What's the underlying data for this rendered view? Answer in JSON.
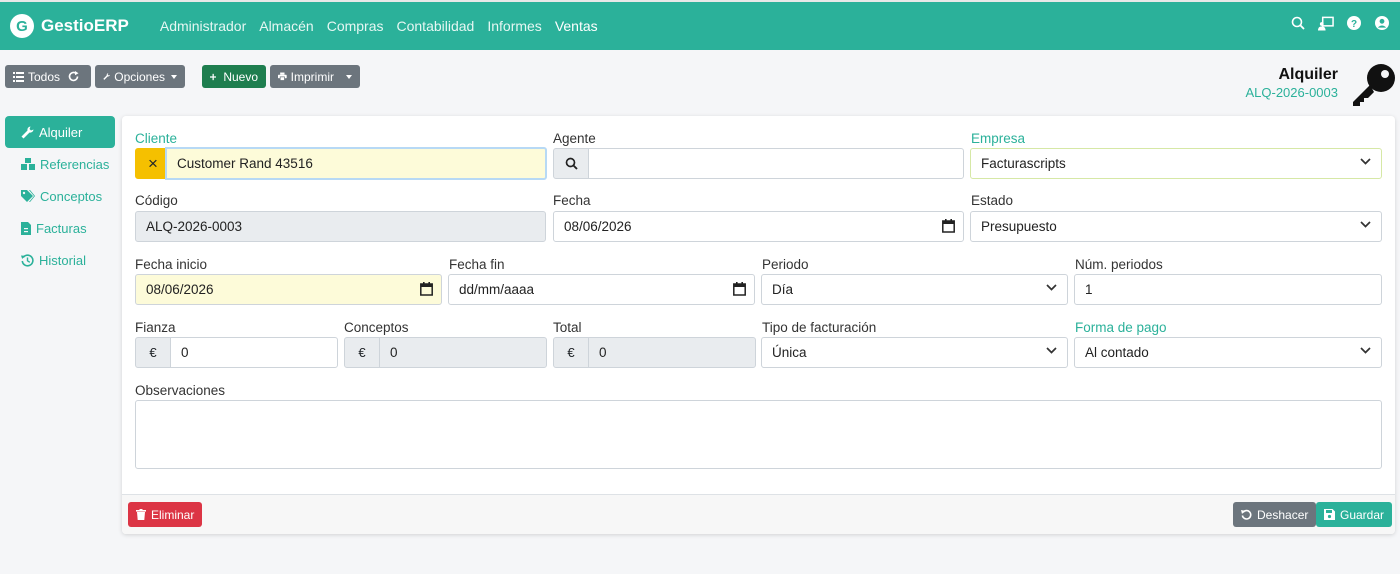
{
  "app": {
    "logo_letter": "G",
    "name": "GestioERP"
  },
  "nav": {
    "items": [
      "Administrador",
      "Almacén",
      "Compras",
      "Contabilidad",
      "Informes",
      "Ventas"
    ]
  },
  "toolbar": {
    "todos": "Todos",
    "opciones": "Opciones",
    "nuevo": "Nuevo",
    "imprimir": "Imprimir"
  },
  "header": {
    "title": "Alquiler",
    "code": "ALQ-2026-0003"
  },
  "sidebar": {
    "items": [
      "Alquiler",
      "Referencias",
      "Conceptos",
      "Facturas",
      "Historial"
    ]
  },
  "form": {
    "cliente": {
      "label": "Cliente",
      "value": "Customer Rand 43516",
      "clear": "×"
    },
    "agente": {
      "label": "Agente",
      "value": ""
    },
    "empresa": {
      "label": "Empresa",
      "value": "Facturascripts"
    },
    "codigo": {
      "label": "Código",
      "value": "ALQ-2026-0003"
    },
    "fecha": {
      "label": "Fecha",
      "value": "08/06/2026"
    },
    "estado": {
      "label": "Estado",
      "value": "Presupuesto"
    },
    "fecha_inicio": {
      "label": "Fecha inicio",
      "value": "08/06/2026"
    },
    "fecha_fin": {
      "label": "Fecha fin",
      "value": "dd/mm/aaaa"
    },
    "periodo": {
      "label": "Periodo",
      "value": "Día"
    },
    "num_periodos": {
      "label": "Núm. periodos",
      "value": "1"
    },
    "fianza": {
      "label": "Fianza",
      "currency": "€",
      "value": "0"
    },
    "conceptos": {
      "label": "Conceptos",
      "currency": "€",
      "value": "0"
    },
    "total": {
      "label": "Total",
      "currency": "€",
      "value": "0"
    },
    "tipo_facturacion": {
      "label": "Tipo de facturación",
      "value": "Única"
    },
    "forma_pago": {
      "label": "Forma de pago",
      "value": "Al contado"
    },
    "observaciones": {
      "label": "Observaciones",
      "value": ""
    }
  },
  "footer": {
    "eliminar": "Eliminar",
    "deshacer": "Deshacer",
    "guardar": "Guardar"
  },
  "colors": {
    "primary": "#2bb19a",
    "danger": "#dc3545",
    "secondary": "#6c757d",
    "success_dark": "#1e7e4f"
  }
}
